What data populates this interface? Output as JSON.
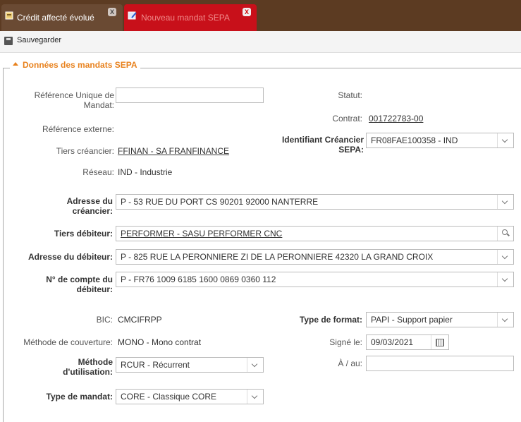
{
  "tabs": [
    {
      "label": "Crédit affecté évolué",
      "close": "X"
    },
    {
      "label": "Nouveau mandat SEPA",
      "close": "X"
    }
  ],
  "toolbar": {
    "save_label": "Sauvegarder"
  },
  "section": {
    "title": "Données des mandats SEPA"
  },
  "form": {
    "rum_label": "Référence Unique de Mandat:",
    "rum_value": "",
    "ref_ext_label": "Référence externe:",
    "tiers_creancier_label": "Tiers créancier:",
    "tiers_creancier_value": "FFINAN - SA FRANFINANCE",
    "reseau_label": "Réseau:",
    "reseau_value": "IND - Industrie",
    "statut_label": "Statut:",
    "contrat_label": "Contrat:",
    "contrat_value": "001722783-00",
    "ident_creancier_label": "Identifiant Créancier SEPA:",
    "ident_creancier_value": "FR08FAE100358 - IND",
    "adr_creancier_label": "Adresse du créancier:",
    "adr_creancier_value": "P - 53 RUE DU PORT CS 90201 92000 NANTERRE",
    "tiers_debiteur_label": "Tiers débiteur:",
    "tiers_debiteur_value": "PERFORMER - SASU PERFORMER CNC",
    "adr_debiteur_label": "Adresse du débiteur:",
    "adr_debiteur_value": "P - 825 RUE LA PERONNIERE ZI DE LA PERONNIERE 42320 LA GRAND CROIX",
    "compte_label": "N° de compte du débiteur:",
    "compte_value": "P - FR76 1009 6185 1600 0869 0360 112",
    "bic_label": "BIC:",
    "bic_value": "CMCIFRPP",
    "methode_couv_label": "Méthode de couverture:",
    "methode_couv_value": "MONO - Mono contrat",
    "methode_util_label": "Méthode d'utilisation:",
    "methode_util_value": "RCUR - Récurrent",
    "type_mandat_label": "Type de mandat:",
    "type_mandat_value": "CORE - Classique CORE",
    "type_format_label": "Type de format:",
    "type_format_value": "PAPI - Support papier",
    "signe_label": "Signé le:",
    "signe_value": "09/03/2021",
    "a_au_label": "À / au:",
    "a_au_value": ""
  }
}
